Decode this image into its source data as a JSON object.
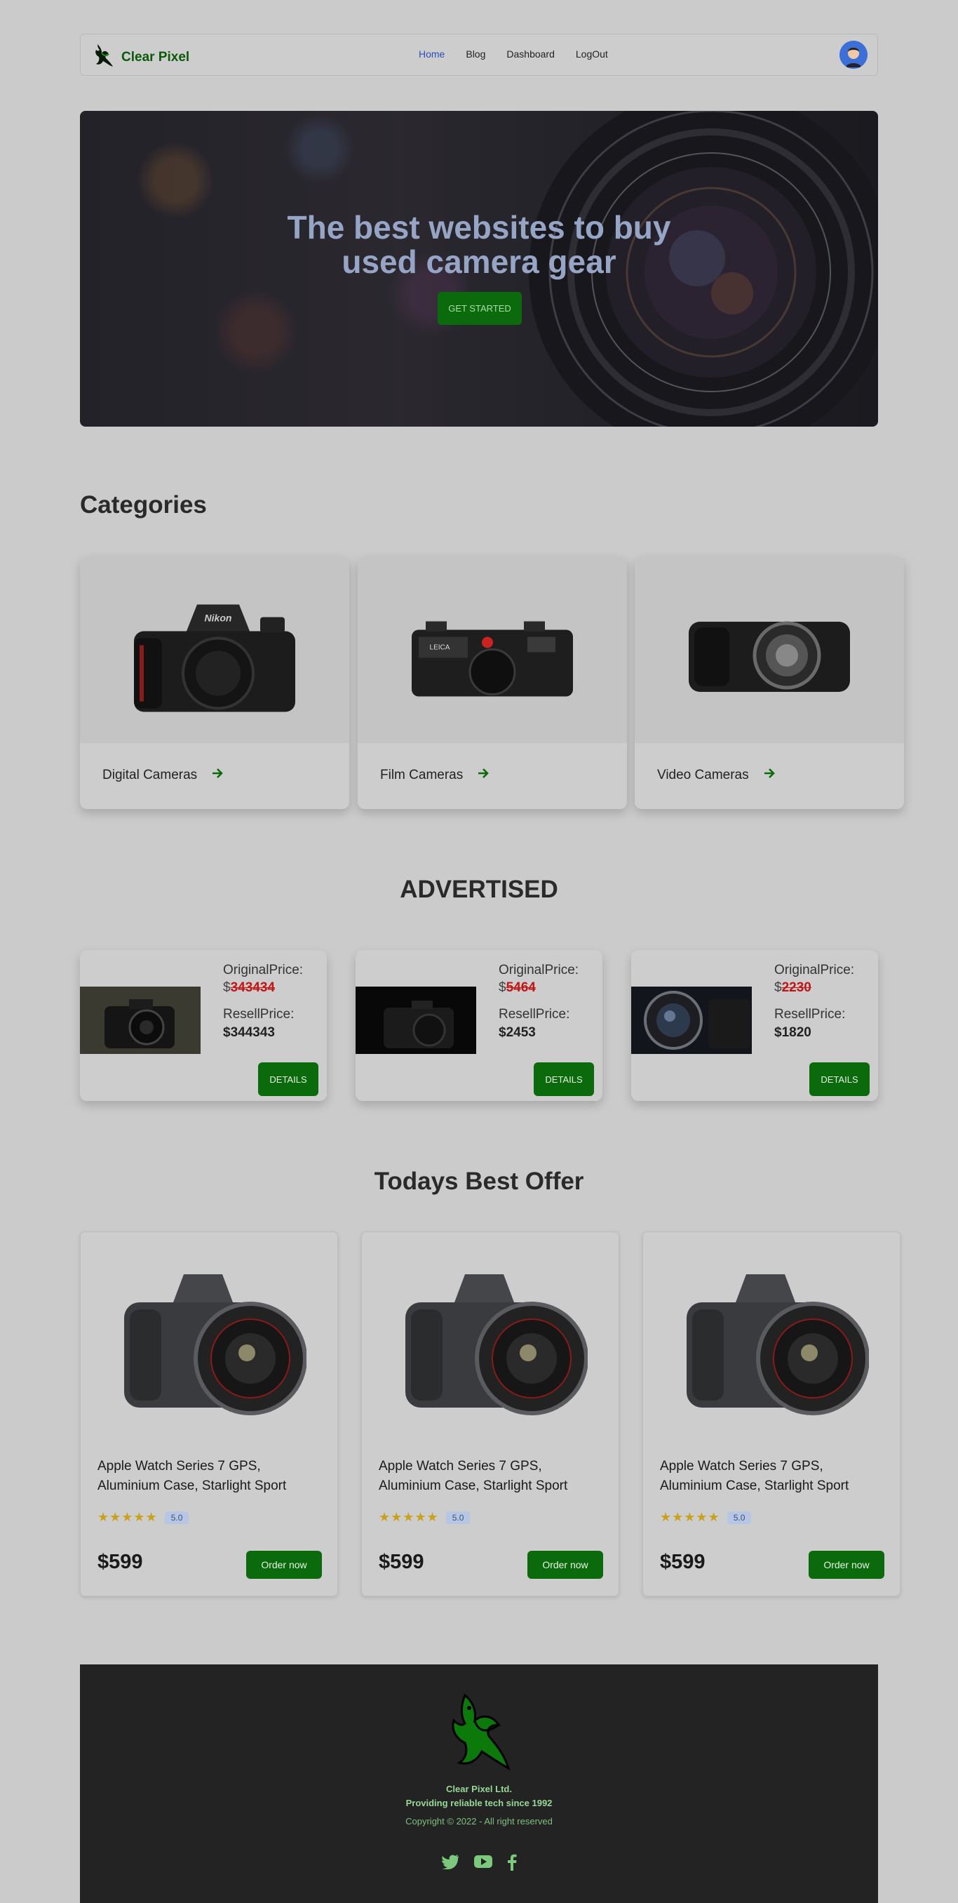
{
  "navbar": {
    "brand": "Clear Pixel",
    "menu": [
      {
        "label": "Home",
        "active": true
      },
      {
        "label": "Blog",
        "active": false
      },
      {
        "label": "Dashboard",
        "active": false
      },
      {
        "label": "LogOut",
        "active": false
      }
    ]
  },
  "hero": {
    "title_line1": "The best websites to buy",
    "title_line2": "used camera gear",
    "button": "GET STARTED"
  },
  "categories": {
    "title": "Categories",
    "items": [
      {
        "label": "Digital Cameras"
      },
      {
        "label": "Film Cameras"
      },
      {
        "label": "Video Cameras"
      }
    ]
  },
  "advertised": {
    "title": "ADVERTISED",
    "original_label": "OriginalPrice:",
    "resell_label": "ResellPrice:",
    "currency": "$",
    "button": "DETAILS",
    "items": [
      {
        "original": "343434",
        "resell": "$344343"
      },
      {
        "original": "5464",
        "resell": "$2453"
      },
      {
        "original": "2230",
        "resell": "$1820"
      }
    ]
  },
  "offers": {
    "title": "Todays Best Offer",
    "items": [
      {
        "name": "Apple Watch Series 7 GPS, Aluminium Case, Starlight Sport",
        "rating": "5.0",
        "stars": 5,
        "price": "$599",
        "button": "Order now"
      },
      {
        "name": "Apple Watch Series 7 GPS, Aluminium Case, Starlight Sport",
        "rating": "5.0",
        "stars": 5,
        "price": "$599",
        "button": "Order now"
      },
      {
        "name": "Apple Watch Series 7 GPS, Aluminium Case, Starlight Sport",
        "rating": "5.0",
        "stars": 5,
        "price": "$599",
        "button": "Order now"
      }
    ]
  },
  "footer": {
    "company": "Clear Pixel Ltd.",
    "tagline": "Providing reliable tech since 1992",
    "copyright": "Copyright © 2022 - All right reserved",
    "socials": [
      "twitter-icon",
      "youtube-icon",
      "facebook-icon"
    ]
  },
  "colors": {
    "brand_green": "#0b6a0b",
    "page_bg": "#cbcbcb",
    "footer_bg": "#232323",
    "strike_red": "#c21616"
  }
}
